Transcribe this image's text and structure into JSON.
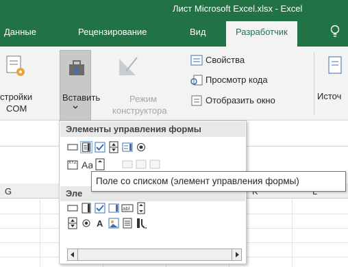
{
  "titlebar": {
    "title": "Лист Microsoft Excel.xlsx - Excel"
  },
  "tabs": [
    {
      "label": "Данные"
    },
    {
      "label": "Рецензирование"
    },
    {
      "label": "Вид"
    },
    {
      "label": "Разработчик"
    }
  ],
  "ribbon": {
    "com_line1": "стройки",
    "com_line2": "COM",
    "insert_label": "Вставить",
    "design_line1": "Режим",
    "design_line2": "конструктора",
    "properties": "Свойства",
    "view_code": "Просмотр кода",
    "show_window": "Отобразить окно",
    "source": "Источ"
  },
  "sheet": {
    "columns": [
      "G",
      "K",
      "L"
    ]
  },
  "dropdown": {
    "form_controls_header": "Элементы управления формы",
    "activex_header_partial": "Эле"
  },
  "tooltip": {
    "text": "Поле со списком (элемент управления формы)"
  },
  "colors": {
    "accent": "#217346",
    "ribbon_bg": "#f3f3f3",
    "hover": "#d6e4f0"
  }
}
